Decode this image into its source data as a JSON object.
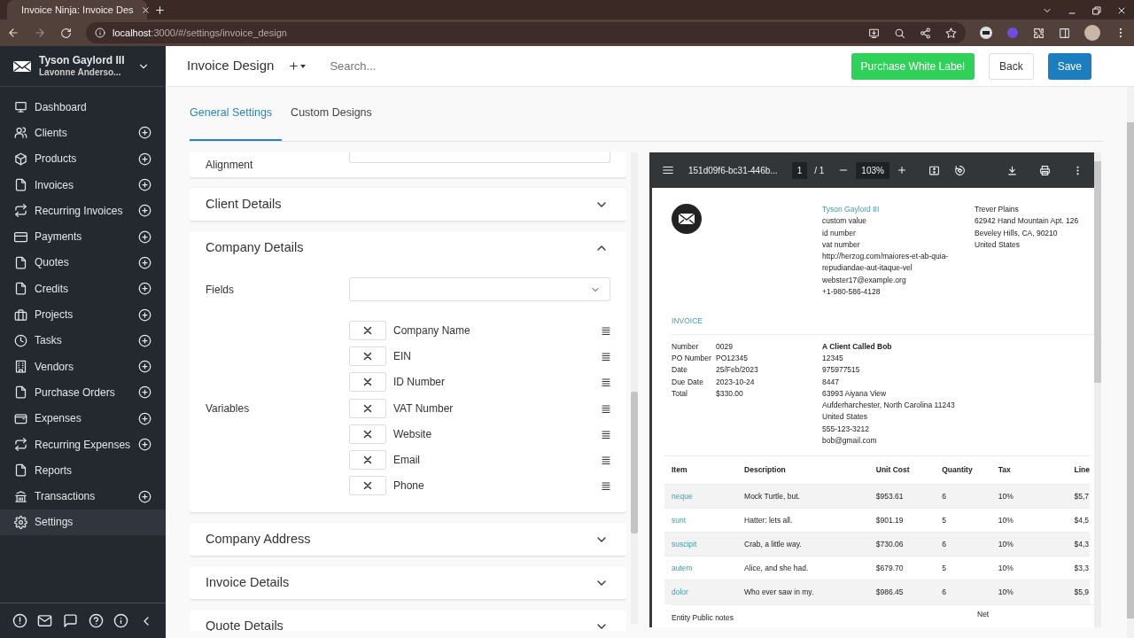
{
  "browser": {
    "tab_title": "Invoice Ninja: Invoice Des",
    "address_host": "localhost",
    "address_rest": ":3000/#/settings/invoice_design"
  },
  "sidebar": {
    "company": "Tyson Gaylord III",
    "user": "Lavonne Anderso...",
    "items": [
      {
        "label": "Dashboard",
        "add": false,
        "selected": false
      },
      {
        "label": "Clients",
        "add": true,
        "selected": false
      },
      {
        "label": "Products",
        "add": true,
        "selected": false
      },
      {
        "label": "Invoices",
        "add": true,
        "selected": false
      },
      {
        "label": "Recurring Invoices",
        "add": true,
        "selected": false
      },
      {
        "label": "Payments",
        "add": true,
        "selected": false
      },
      {
        "label": "Quotes",
        "add": true,
        "selected": false
      },
      {
        "label": "Credits",
        "add": true,
        "selected": false
      },
      {
        "label": "Projects",
        "add": true,
        "selected": false
      },
      {
        "label": "Tasks",
        "add": true,
        "selected": false
      },
      {
        "label": "Vendors",
        "add": true,
        "selected": false
      },
      {
        "label": "Purchase Orders",
        "add": true,
        "selected": false
      },
      {
        "label": "Expenses",
        "add": true,
        "selected": false
      },
      {
        "label": "Recurring Expenses",
        "add": true,
        "selected": false
      },
      {
        "label": "Reports",
        "add": false,
        "selected": false
      },
      {
        "label": "Transactions",
        "add": true,
        "selected": false
      },
      {
        "label": "Settings",
        "add": false,
        "selected": true
      }
    ]
  },
  "header": {
    "title": "Invoice Design",
    "search_placeholder": "Search...",
    "buttons": [
      {
        "label": "Purchase White Label",
        "kind": "success"
      },
      {
        "label": "Back",
        "kind": "outline"
      },
      {
        "label": "Save",
        "kind": "primary"
      }
    ]
  },
  "tabs": [
    {
      "label": "General Settings",
      "selected": true
    },
    {
      "label": "Custom Designs",
      "selected": false
    }
  ],
  "settings_panel": {
    "cards": [
      {
        "kind": "field",
        "label": "Alignment"
      },
      {
        "kind": "section",
        "title": "Client Details",
        "expanded": false
      },
      {
        "kind": "section",
        "title": "Company Details",
        "expanded": true,
        "fields_label": "Fields",
        "variables_label": "Variables",
        "variables": [
          "Company Name",
          "EIN",
          "ID Number",
          "VAT Number",
          "Website",
          "Email",
          "Phone"
        ]
      },
      {
        "kind": "section",
        "title": "Company Address",
        "expanded": false
      },
      {
        "kind": "section",
        "title": "Invoice Details",
        "expanded": false
      },
      {
        "kind": "section",
        "title": "Quote Details",
        "expanded": false
      }
    ]
  },
  "pdf_viewer": {
    "file_name": "151d09f6-bc31-446b...",
    "page": "1",
    "page_count": "/ 1",
    "zoom": "103%",
    "document": {
      "company_lines": [
        "Tyson Gaylord III",
        "custom value",
        "id number",
        "vat number",
        "http://herzog.com/maiores-et-ab-quia-repudiandae-aut-itaque-vel",
        "webster17@example.org",
        "+1-980-586-4128"
      ],
      "address_lines": [
        "Trever Plains",
        "62942 Hand Mountain Apt. 126",
        "Beveley Hills, CA, 90210",
        "United States"
      ],
      "title": "INVOICE",
      "details": [
        {
          "label": "Number",
          "value": "0029"
        },
        {
          "label": "PO Number",
          "value": "PO12345"
        },
        {
          "label": "Date",
          "value": "25/Feb/2023"
        },
        {
          "label": "Due Date",
          "value": "2023-10-24"
        },
        {
          "label": "Total",
          "value": "$330.00"
        }
      ],
      "client_lines": [
        "A Client Called Bob",
        "12345",
        "975977515",
        "8447",
        "63993 Aiyana View",
        "Aufderharchester, North Carolina 11243",
        "United States",
        "555-123-3212",
        "bob@gmail.com"
      ],
      "table": {
        "columns": [
          "Item",
          "Description",
          "Unit Cost",
          "Quantity",
          "Tax",
          "Line"
        ],
        "rows": [
          [
            "neque",
            "Mock Turtle, but.",
            "$953.61",
            "6",
            "10%",
            "$5,7"
          ],
          [
            "sunt",
            "Hatter: lets all.",
            "$901.19",
            "5",
            "10%",
            "$4,5"
          ],
          [
            "suscipit",
            "Crab, a little way.",
            "$730.06",
            "6",
            "10%",
            "$4,3"
          ],
          [
            "autem",
            "Alice, and she had.",
            "$679.70",
            "5",
            "10%",
            "$3,3"
          ],
          [
            "dolor",
            "Who ever saw in my.",
            "$986.45",
            "6",
            "10%",
            "$5,9"
          ]
        ]
      },
      "notes_label": "Entity Public notes",
      "totals_label": "Net"
    }
  }
}
